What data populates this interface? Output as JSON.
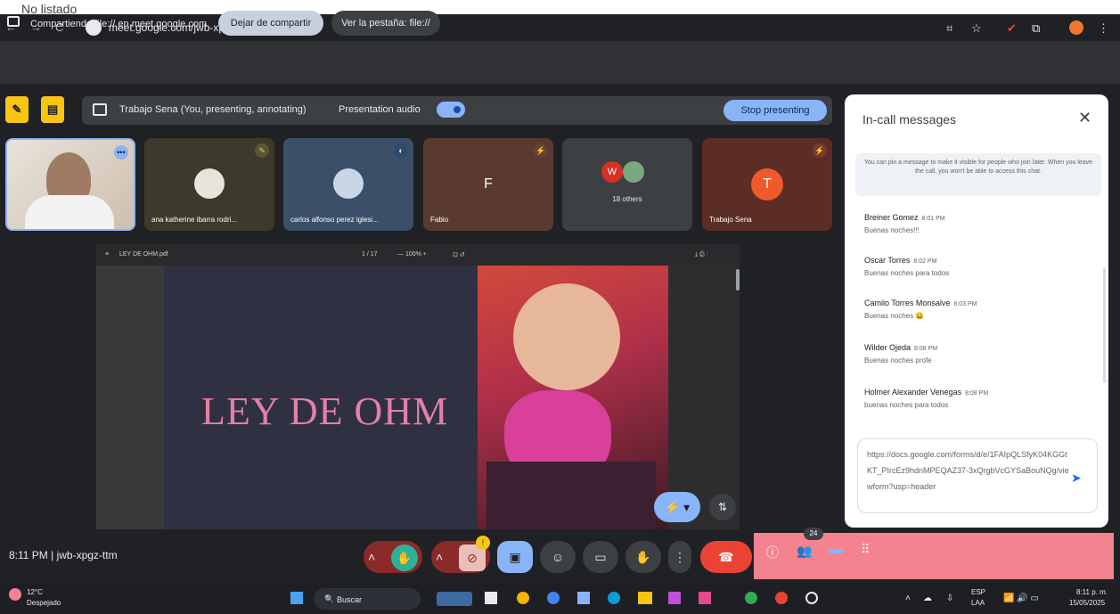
{
  "header_label": "No listado",
  "browser": {
    "nav_back": "←",
    "nav_forward": "→",
    "nav_reload": "C",
    "url": "meet.google.com/jwb-xpgz-ttm"
  },
  "sharebar": {
    "sharing_text": "Compartiendo file:// en meet.google.com",
    "stop_sharing": "Dejar de compartir",
    "view_tab": "Ver la pestaña: file://"
  },
  "presentation": {
    "title": "Trabajo Sena (You, presenting, annotating)",
    "audio_label": "Presentation audio",
    "stop_button": "Stop presenting"
  },
  "tiles": [
    {
      "name": "",
      "letter": ""
    },
    {
      "name": "ana katherine ibarra rodri...",
      "letter": ""
    },
    {
      "name": "carlos alfonso perez iglesi...",
      "letter": ""
    },
    {
      "name": "Fabio",
      "letter": "F"
    },
    {
      "name": "18 others",
      "letter": "W"
    },
    {
      "name": "Trabajo Sena",
      "letter": "T"
    }
  ],
  "slide": {
    "filename": "LEY DE OHM.pdf",
    "page": "1 / 17",
    "title": "LEY DE OHM"
  },
  "bottom": {
    "time_code": "8:11 PM | jwb-xpgz-ttm",
    "participants_count": "24"
  },
  "chat": {
    "title": "In-call messages",
    "close": "✕",
    "pin_note": "You can pin a message to make it visible for people who join later. When you leave the call, you won't be able to access this chat.",
    "messages": [
      {
        "sender": "Breiner Gomez",
        "time": "8:01 PM",
        "text": "Buenas noches!!!"
      },
      {
        "sender": "Oscar Torres",
        "time": "8:02 PM",
        "text": "Buenas noches para todos"
      },
      {
        "sender": "Camilo Torres Monsalve",
        "time": "8:03 PM",
        "text": "Buenas noches 😀"
      },
      {
        "sender": "Wilder Ojeda",
        "time": "8:08 PM",
        "text": "Buenas noches profe"
      },
      {
        "sender": "Holmer Alexander Venegas",
        "time": "8:08 PM",
        "text": "buenas noches para todos"
      }
    ],
    "input_text": "https://docs.google.com/forms/d/e/1FAIpQLSfyK04KGGtKT_PIrcEz9hdnMPEQAZ37-3xQrgbVcGYSaBouNQg/viewform?usp=header"
  },
  "taskbar": {
    "temp": "12°C",
    "weather": "Despejado",
    "search": "Buscar",
    "lang1": "ESP",
    "lang2": "LAA",
    "clock_time": "8:11 p. m.",
    "clock_date": "15/05/2025"
  },
  "colors": {
    "meet_bg": "#202124",
    "accent_blue": "#8ab4f8",
    "stop_share_bg": "#c8d0e0",
    "pink_panel": "#f2838f",
    "end_call": "#ea4335",
    "slide_title": "#e67fa5"
  }
}
